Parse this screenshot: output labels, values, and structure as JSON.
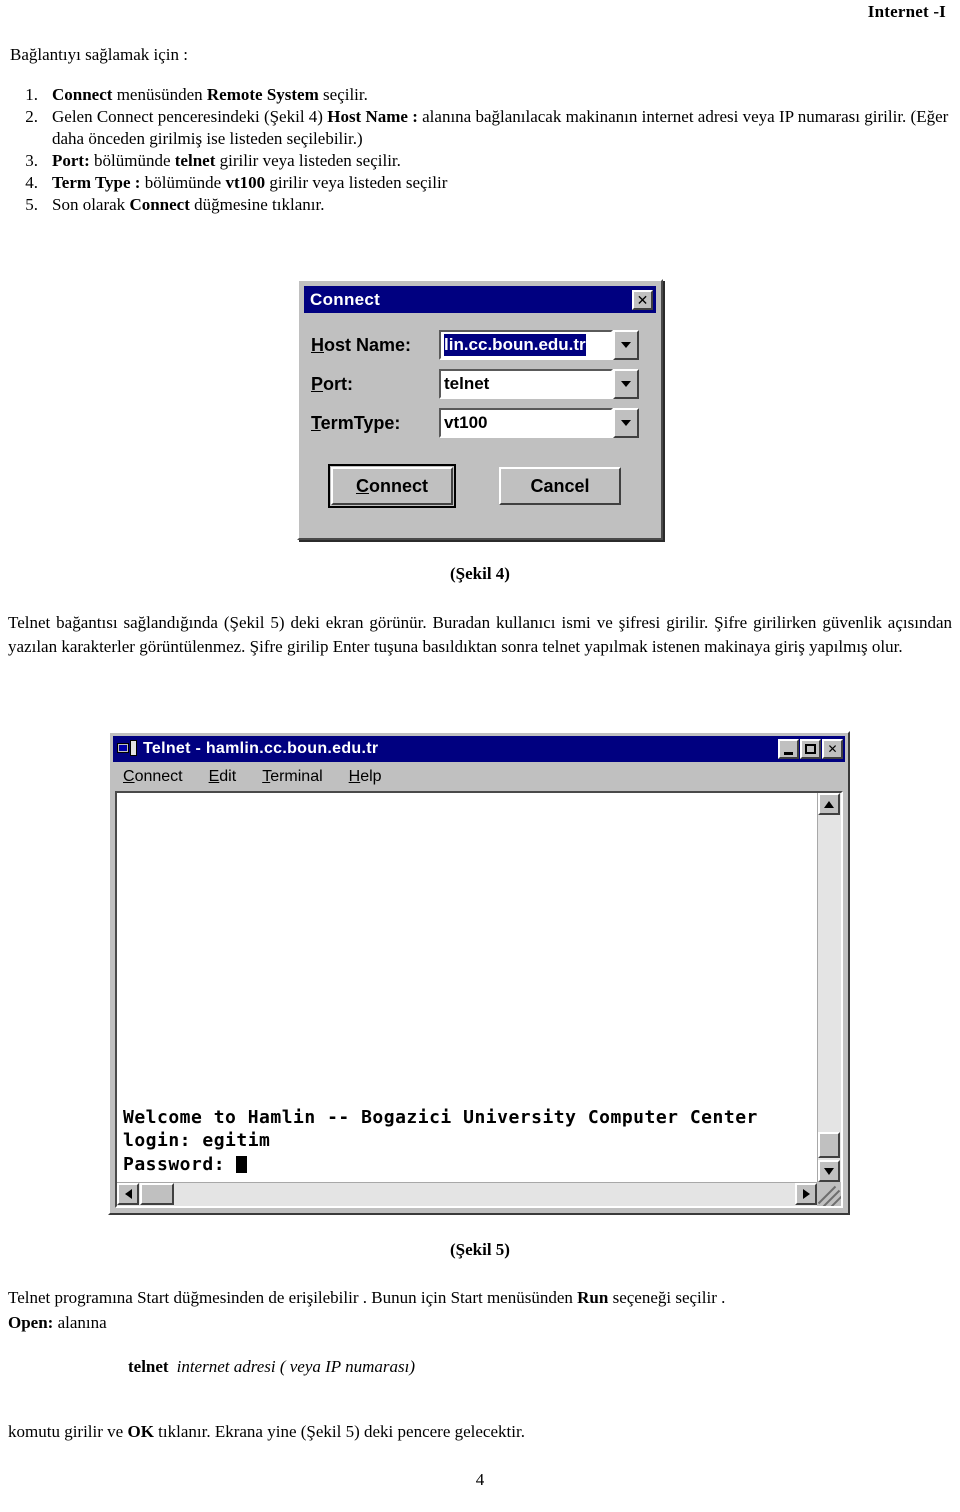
{
  "document": {
    "header_title": "Internet -I",
    "page_number": "4",
    "intro_line": "Bağlantıyı sağlamak için :"
  },
  "steps": [
    {
      "num": "1.",
      "html": "<b>Connect</b> menüsünden <b>Remote System</b> seçilir."
    },
    {
      "num": "2.",
      "html": "Gelen Connect penceresindeki  (Şekil 4)  <b>Host Name :</b> alanına  bağlanılacak makinanın internet adresi veya IP numarası girilir. (Eğer daha önceden girilmiş ise listeden seçilebilir.)"
    },
    {
      "num": "3.",
      "html": "<b>Port:</b> bölümünde <b>telnet</b> girilir veya listeden seçilir."
    },
    {
      "num": "4.",
      "html": "<b>Term Type :</b> bölümünde <b>vt100</b> girilir veya listeden seçilir"
    },
    {
      "num": "5.",
      "html": "Son olarak  <b>Connect</b> düğmesine tıklanır."
    }
  ],
  "connect_dialog": {
    "title": "Connect",
    "close_label": "✕",
    "fields": [
      {
        "label_pre": "",
        "label_accel": "H",
        "label_post": "ost Name:",
        "value": "lin.cc.boun.edu.tr",
        "selected": true
      },
      {
        "label_pre": "",
        "label_accel": "P",
        "label_post": "ort:",
        "value": "telnet",
        "selected": false
      },
      {
        "label_pre": "",
        "label_accel": "T",
        "label_post": "ermType:",
        "value": "vt100",
        "selected": false
      }
    ],
    "buttons": {
      "connect_accel": "C",
      "connect_rest": "onnect",
      "cancel": "Cancel"
    }
  },
  "caption_figure_4": "(Şekil 4)",
  "caption_figure_5": "(Şekil 5)",
  "paragraph_middle": "Telnet bağantısı sağlandığında  (Şekil 5) deki ekran görünür. Buradan kullanıcı ismi ve şifresi girilir. Şifre girilirken güvenlik açısından yazılan karakterler görüntülenmez. Şifre  girilip  Enter  tuşuna  basıldıktan  sonra   telnet  yapılmak istenen makinaya giriş yapılmış olur.",
  "telnet_window": {
    "title": "Telnet - hamlin.cc.boun.edu.tr",
    "icon": "computer-icon",
    "controls": {
      "minimize": "minimize-icon",
      "maximize": "maximize-icon",
      "close": "✕"
    },
    "menu": [
      {
        "accel": "C",
        "rest": "onnect"
      },
      {
        "accel": "E",
        "rest": "dit"
      },
      {
        "accel": "T",
        "rest": "erminal"
      },
      {
        "accel": "H",
        "rest": "elp"
      }
    ],
    "terminal_lines": [
      "Welcome to Hamlin -- Bogazici University Computer Center",
      "login: egitim",
      "Password: "
    ]
  },
  "paragraph_bottom": {
    "line1_html": "Telnet programına Start düğmesinden de erişilebilir . Bunun için Start menüsünden <b>Run</b> seçeneği seçilir .",
    "line2_html": "<b>Open:</b> alanına",
    "command_bold": "telnet",
    "command_italic": "internet adresi ( veya IP numarası)",
    "line3_html": "komutu girilir  ve <b>OK</b> tıklanır. Ekrana yine  (Şekil 5) deki pencere gelecektir."
  },
  "colors": {
    "titlebar": "#000080",
    "window_face": "#c0c0c0",
    "highlight_text_bg": "#000080",
    "page_bg": "#ffffff"
  }
}
